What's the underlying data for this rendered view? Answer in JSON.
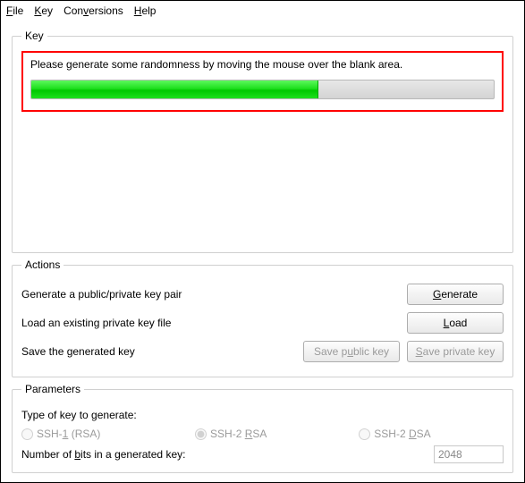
{
  "menu": {
    "file": "File",
    "key": "Key",
    "conversions": "Conversions",
    "help": "Help"
  },
  "key_section": {
    "legend": "Key",
    "instruction": "Please generate some randomness by moving the mouse over the blank area.",
    "progress_percent": 62
  },
  "actions": {
    "legend": "Actions",
    "generate_label": "Generate a public/private key pair",
    "generate_btn": "Generate",
    "load_label": "Load an existing private key file",
    "load_btn": "Load",
    "save_label": "Save the generated key",
    "save_public_btn": "Save public key",
    "save_private_btn": "Save private key"
  },
  "parameters": {
    "legend": "Parameters",
    "type_label": "Type of key to generate:",
    "ssh1_rsa": "SSH-1 (RSA)",
    "ssh2_rsa": "SSH-2 RSA",
    "ssh2_dsa": "SSH-2 DSA",
    "bits_label": "Number of bits in a generated key:",
    "bits_value": "2048"
  }
}
